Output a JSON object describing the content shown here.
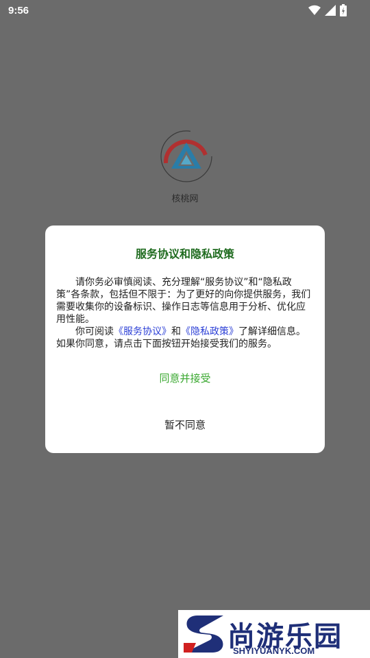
{
  "status_bar": {
    "time": "9:56",
    "icons": [
      "wifi-icon",
      "signal-icon",
      "battery-icon"
    ]
  },
  "splash": {
    "app_name": "核桃网",
    "logo": "app-logo-icon"
  },
  "dialog": {
    "title": "服务协议和隐私政策",
    "para1": "请你务必审慎阅读、充分理解“服务协议”和“隐私政策”各条款，包括但不限于：为了更好的向你提供服务，我们需要收集你的设备标识、操作日志等信息用于分析、优化应用性能。",
    "para2_prefix": "你可阅读",
    "link_service": "《服务协议》",
    "and": "和",
    "link_privacy": "《隐私政策》",
    "para2_suffix": "了解详细信息。如果你同意，请点击下面按钮开始接受我们的服务。",
    "agree_button": "同意并接受",
    "decline_button": "暂不同意"
  },
  "watermark": {
    "title": "尚游乐园",
    "url": "SHYIYUANYK.COM"
  },
  "colors": {
    "overlay": "#6b6b6b",
    "title_green": "#1f6b1f",
    "agree_green": "#3aa830",
    "link_blue": "#2b3fd6",
    "watermark_navy": "#1f2f78"
  }
}
